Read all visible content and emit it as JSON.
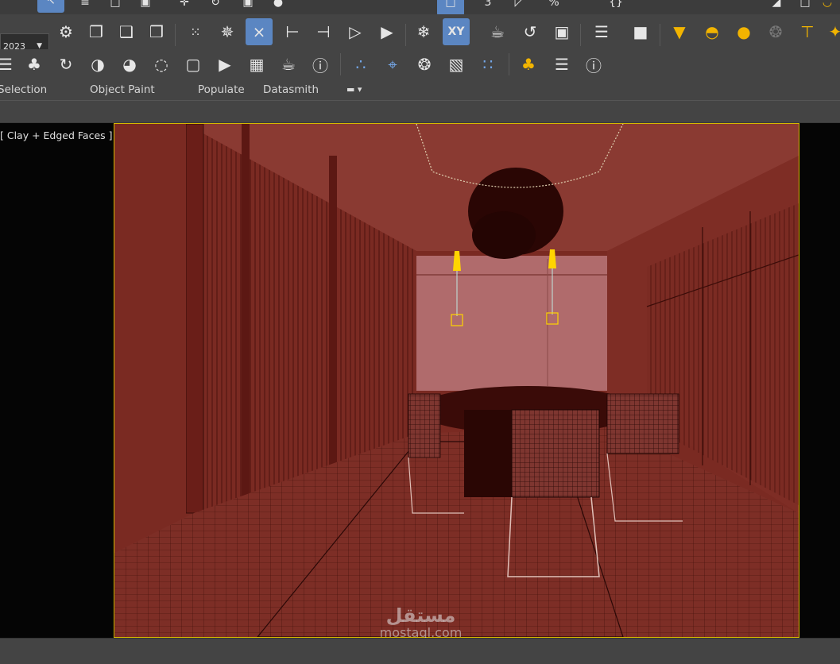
{
  "toolbar": {
    "version_label": "2023",
    "row1_icons": [
      "select-object-icon",
      "select-by-name-icon",
      "rectangular-region-icon",
      "window-crossing-icon",
      "move-icon",
      "rotate-icon",
      "scale-icon",
      "settings-icon",
      "snaps-toggle-icon",
      "angle-snap-icon",
      "percent-snap-icon",
      "spinner-snap-icon",
      "mirror-icon",
      "align-icon",
      "dope-sheet-icon",
      "render-setup-icon"
    ],
    "row2_icons": [
      "scene-explorer-icon",
      "nested-selection-icon",
      "link-icon",
      "unlink-icon",
      "bind-icon",
      "select-region-icon",
      "grid-snap-icon",
      "axis-icon",
      "snap-icon",
      "snap-alt-icon",
      "snap-second-icon",
      "paint-icon",
      "shard-icon",
      "freeze-icon",
      "xy-plane-icon",
      "teapot-icon",
      "rotate-view-icon",
      "box-icon",
      "list-icon",
      "camera-icon",
      "light-spot-icon",
      "dome-icon",
      "sphere-icon",
      "globe-icon",
      "lamp-icon",
      "bulb-icon"
    ],
    "row3_icons": [
      "layers-icon",
      "tree-icon",
      "cycle-icon",
      "material-icon",
      "palette-icon",
      "bulb-settings-icon",
      "window-icon",
      "play-icon",
      "viewport-icon",
      "teapot-render-icon",
      "help-icon",
      "node-graph-icon",
      "target-icon",
      "particles-icon",
      "ruler-icon",
      "graph-icon",
      "forest-icon",
      "list-view-icon",
      "help-circle-icon"
    ]
  },
  "tabs": [
    "Selection",
    "Object Paint",
    "Populate",
    "Datasmith"
  ],
  "viewport": {
    "label": "[ Clay + Edged Faces ]",
    "border_color": "#d5b800",
    "scene_description_tint": "#7a2a22"
  },
  "watermark": {
    "arabic": "مستقل",
    "latin": "mostaql.com"
  }
}
